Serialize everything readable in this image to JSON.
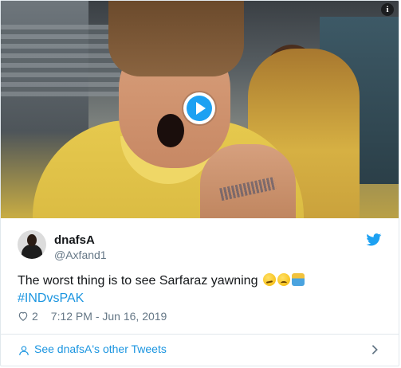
{
  "media": {
    "play_icon": "play-icon",
    "info_label": "i"
  },
  "user": {
    "name": "dnafsA",
    "handle": "@Axfand1"
  },
  "tweet": {
    "text": "The worst thing is to see Sarfaraz yawning ",
    "hashtag": "#INDvsPAK",
    "emojis": [
      "slightly-frowning-face",
      "confused-face",
      "person-facepalming"
    ]
  },
  "meta": {
    "likes": "2",
    "timestamp": "7:12 PM - Jun 16, 2019"
  },
  "footer": {
    "see_more": "See dnafsA's other Tweets"
  },
  "colors": {
    "accent": "#1da1f2",
    "link": "#1b95e0",
    "muted": "#657786",
    "text": "#14171a",
    "border": "#e1e8ed"
  }
}
